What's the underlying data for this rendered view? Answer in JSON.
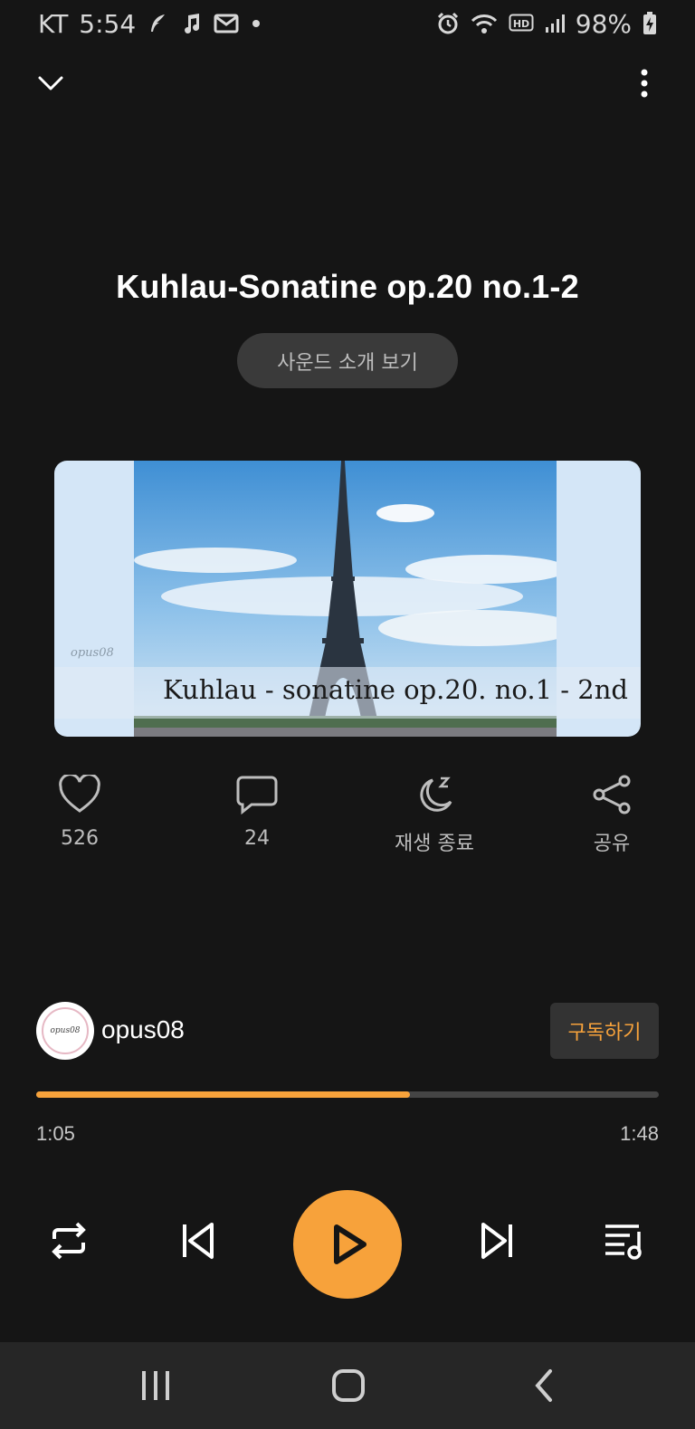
{
  "status_bar": {
    "carrier": "KT",
    "time": "5:54",
    "battery": "98%",
    "icons": [
      "feather-icon",
      "music-note-icon",
      "mail-icon",
      "dot-icon",
      "alarm-icon",
      "wifi-icon",
      "hd-voice-icon",
      "signal-icon",
      "battery-charging-icon"
    ]
  },
  "header": {
    "collapse_icon": "chevron-down-icon",
    "more_icon": "more-vertical-icon"
  },
  "track": {
    "title": "Kuhlau-Sonatine op.20 no.1-2",
    "intro_button": "사운드 소개 보기"
  },
  "artwork": {
    "watermark": "opus08",
    "caption": "Kuhlau - sonatine op.20. no.1 - 2nd"
  },
  "actions": {
    "like": {
      "icon": "heart-icon",
      "label": "526"
    },
    "comment": {
      "icon": "comment-icon",
      "label": "24"
    },
    "sleep": {
      "icon": "moon-sleep-icon",
      "label": "재생 종료"
    },
    "share": {
      "icon": "share-icon",
      "label": "공유"
    }
  },
  "channel": {
    "name": "opus08",
    "avatar_text": "opus08",
    "subscribe_label": "구독하기"
  },
  "player": {
    "current_time": "1:05",
    "total_time": "1:48",
    "progress_fraction": 0.6,
    "controls": [
      "repeat-icon",
      "previous-icon",
      "play-icon",
      "next-icon",
      "playlist-icon"
    ]
  },
  "navbar": {
    "buttons": [
      "recents-icon",
      "home-icon",
      "back-icon"
    ]
  },
  "colors": {
    "background": "#151515",
    "accent": "#f7a23b",
    "muted_text": "#bdbdbd"
  }
}
